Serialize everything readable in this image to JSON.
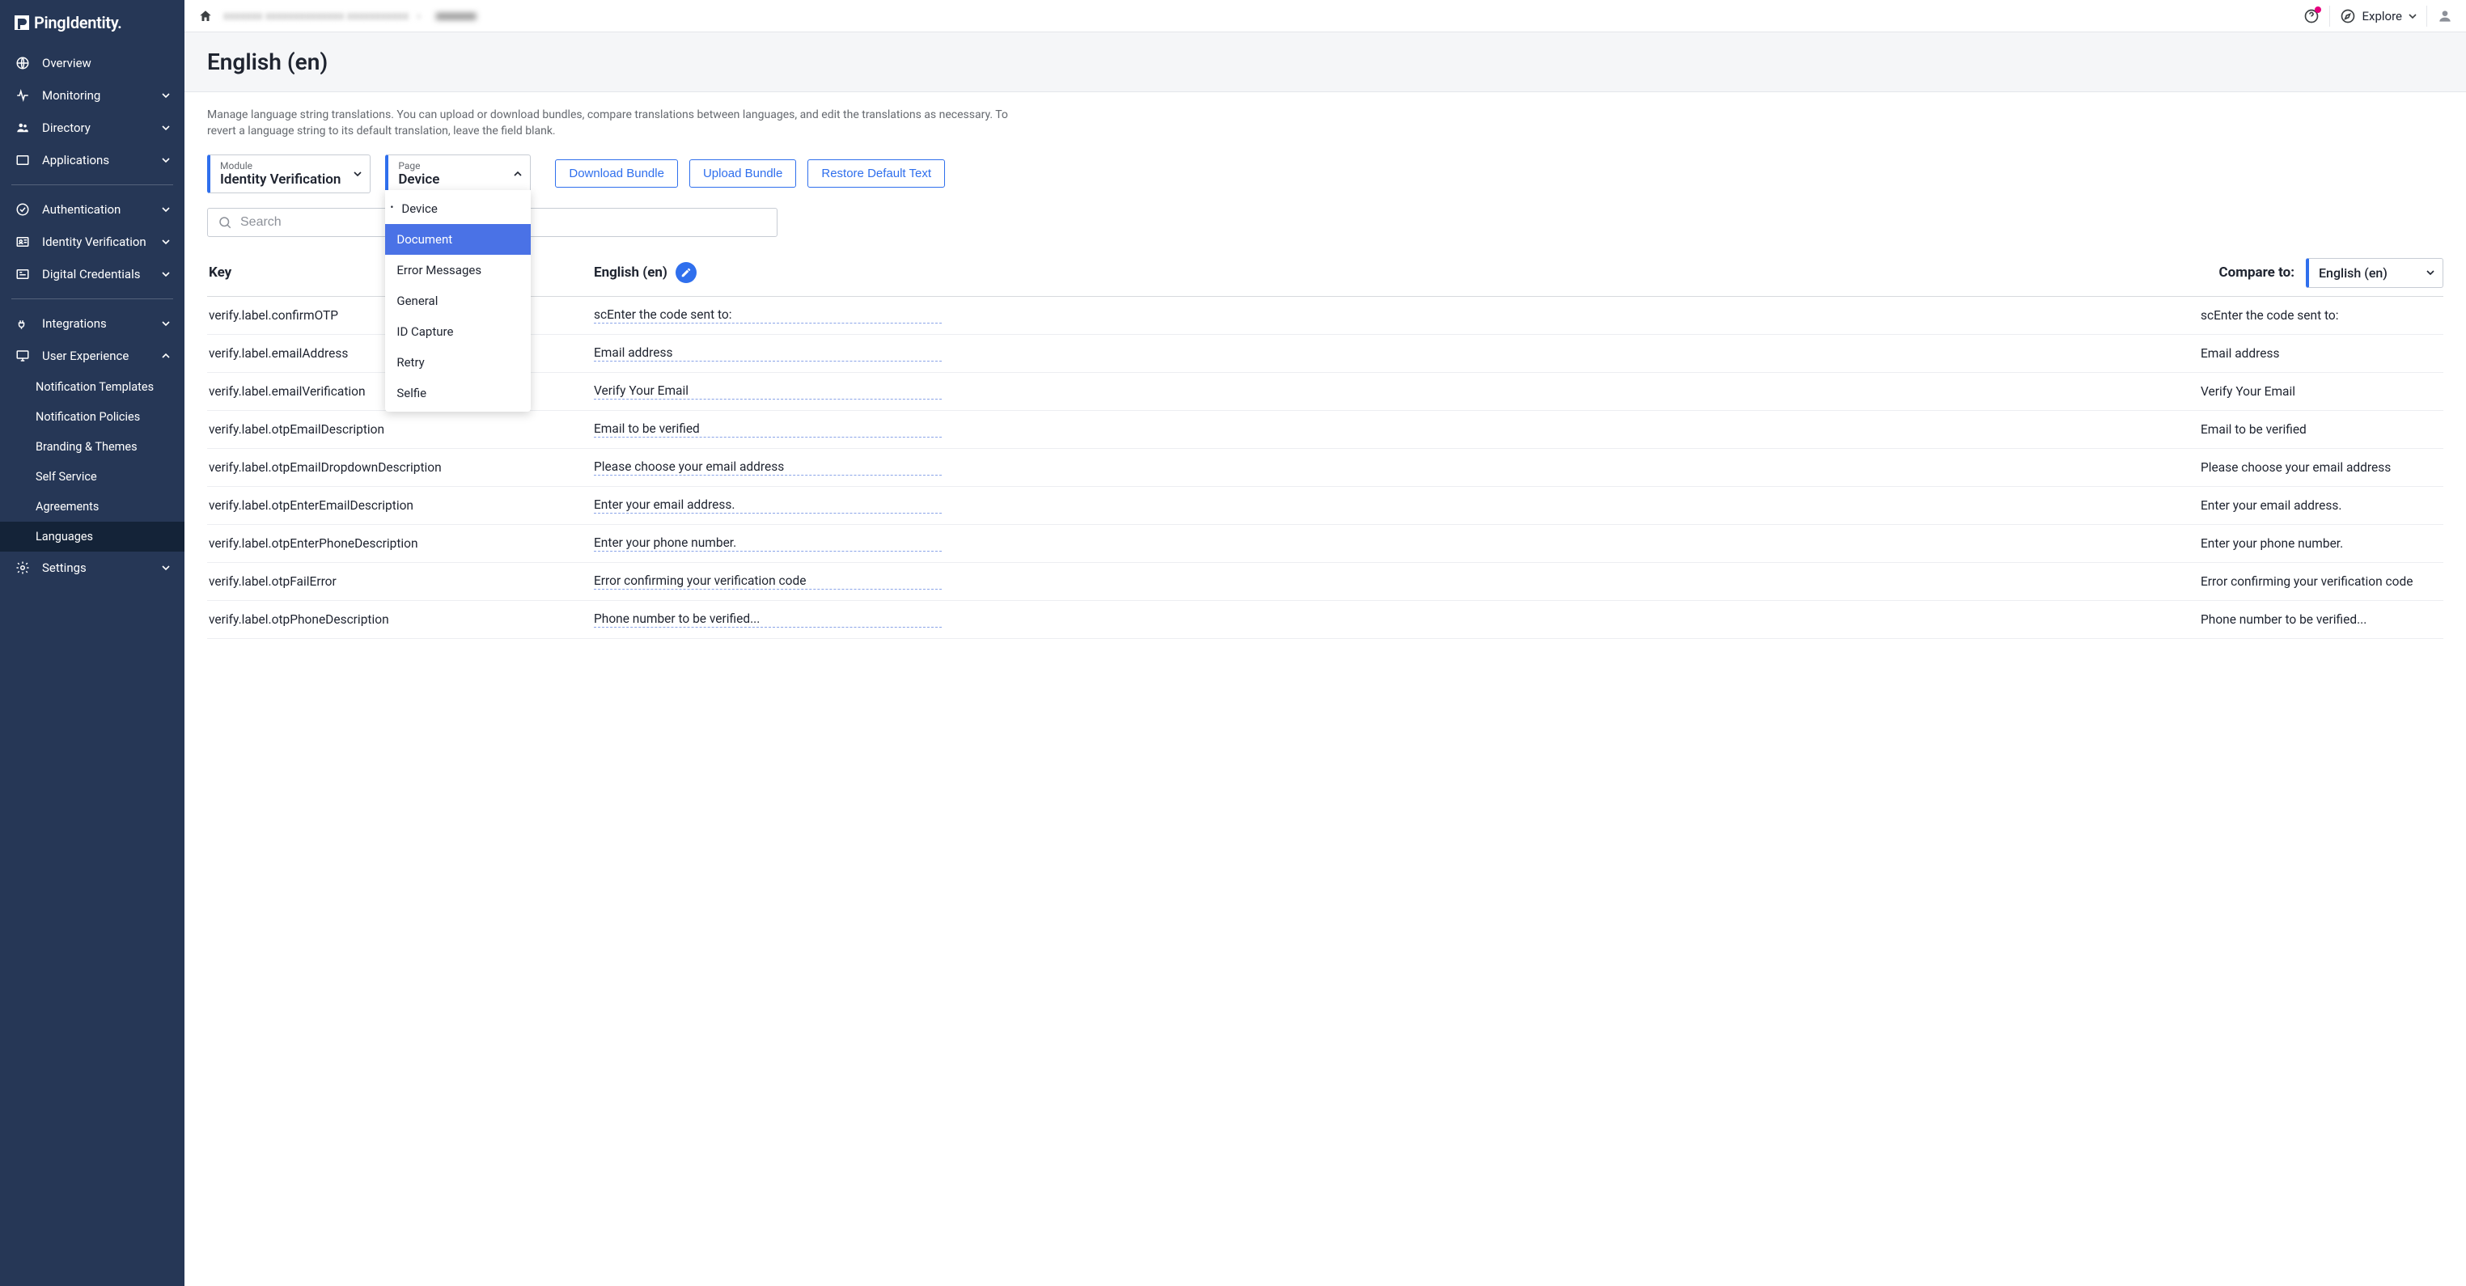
{
  "brand": "PingIdentity.",
  "topbar": {
    "explore": "Explore"
  },
  "nav": {
    "overview": "Overview",
    "monitoring": "Monitoring",
    "directory": "Directory",
    "applications": "Applications",
    "authentication": "Authentication",
    "identity_verification": "Identity Verification",
    "digital_credentials": "Digital Credentials",
    "integrations": "Integrations",
    "user_experience": "User Experience",
    "ux_children": {
      "notification_templates": "Notification Templates",
      "notification_policies": "Notification Policies",
      "branding_themes": "Branding & Themes",
      "self_service": "Self Service",
      "agreements": "Agreements",
      "languages": "Languages"
    },
    "settings": "Settings"
  },
  "page": {
    "title": "English (en)",
    "description": "Manage language string translations. You can upload or download bundles, compare translations between languages, and edit the translations as necessary. To revert a language string to its default translation, leave the field blank."
  },
  "filters": {
    "module_label": "Module",
    "module_value": "Identity Verification",
    "page_label": "Page",
    "page_value": "Device",
    "page_options": [
      "Device",
      "Document",
      "Error Messages",
      "General",
      "ID Capture",
      "Retry",
      "Selfie"
    ],
    "page_current": "Device",
    "page_hovered": "Document"
  },
  "buttons": {
    "download": "Download Bundle",
    "upload": "Upload Bundle",
    "restore": "Restore Default Text"
  },
  "search": {
    "placeholder": "Search"
  },
  "table_head": {
    "key": "Key",
    "english": "English (en)",
    "compare_to": "Compare to:",
    "compare_value": "English (en)"
  },
  "rows": [
    {
      "key": "verify.label.confirmOTP",
      "en": "scEnter the code sent to:",
      "cmp": "scEnter the code sent to:"
    },
    {
      "key": "verify.label.emailAddress",
      "en": "Email address",
      "cmp": "Email address"
    },
    {
      "key": "verify.label.emailVerification",
      "en": "Verify Your Email",
      "cmp": "Verify Your Email"
    },
    {
      "key": "verify.label.otpEmailDescription",
      "en": "Email to be verified",
      "cmp": "Email to be verified"
    },
    {
      "key": "verify.label.otpEmailDropdownDescription",
      "en": "Please choose your email address",
      "cmp": "Please choose your email address"
    },
    {
      "key": "verify.label.otpEnterEmailDescription",
      "en": "Enter your email address.",
      "cmp": "Enter your email address."
    },
    {
      "key": "verify.label.otpEnterPhoneDescription",
      "en": "Enter your phone number.",
      "cmp": "Enter your phone number."
    },
    {
      "key": "verify.label.otpFailError",
      "en": "Error confirming your verification code",
      "cmp": "Error confirming your verification code"
    },
    {
      "key": "verify.label.otpPhoneDescription",
      "en": "Phone number to be verified...",
      "cmp": "Phone number to be verified..."
    }
  ]
}
